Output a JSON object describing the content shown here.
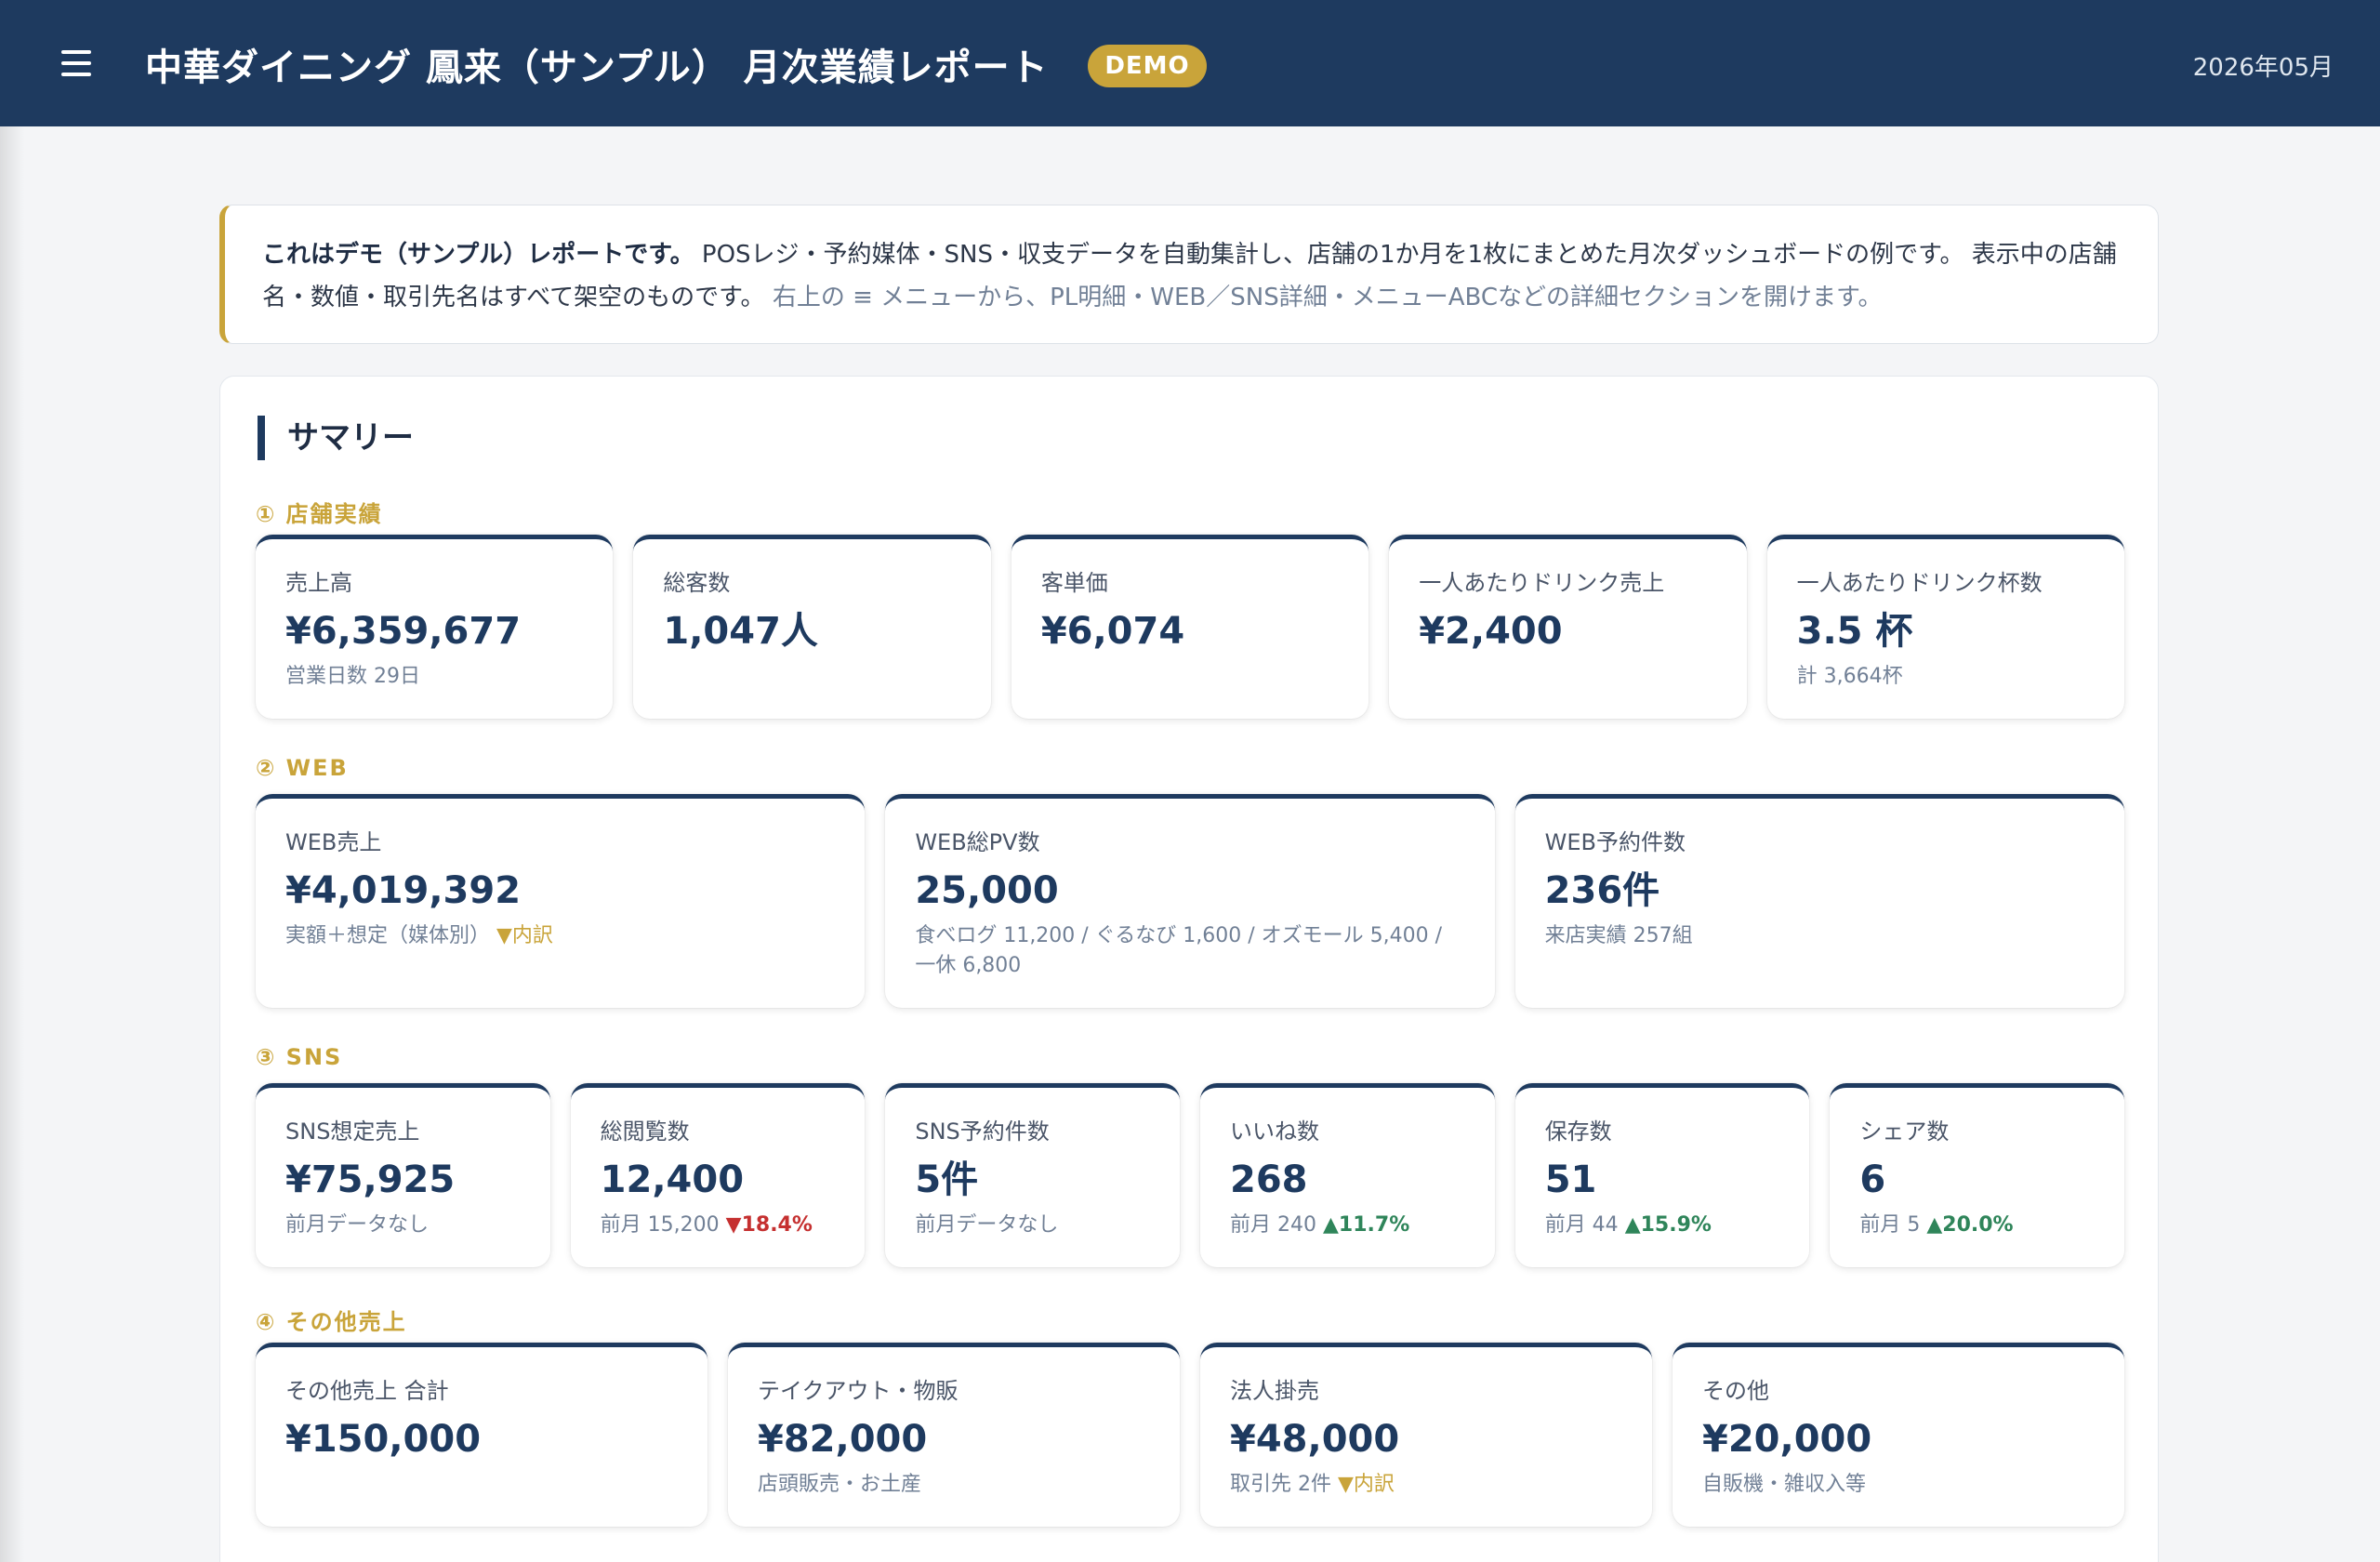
{
  "header": {
    "title": "中華ダイニング 鳳来（サンプル） 月次業績レポート",
    "badge": "DEMO",
    "date": "2026年05月"
  },
  "notice": {
    "lead": "これはデモ（サンプル）レポートです。",
    "body": "POSレジ・予約媒体・SNS・収支データを自動集計し、店舗の1か月を1枚にまとめた月次ダッシュボードの例です。 表示中の店舗名・数値・取引先名はすべて架空のものです。",
    "hint": "右上の ≡ メニューから、PL明細・WEB／SNS詳細・メニューABCなどの詳細セクションを開けます。"
  },
  "summary": {
    "title": "サマリー",
    "sections": {
      "store": {
        "label": "① 店舗実績",
        "cards": [
          {
            "label": "売上高",
            "value": "¥6,359,677",
            "sub": "営業日数 29日"
          },
          {
            "label": "総客数",
            "value": "1,047人",
            "sub": ""
          },
          {
            "label": "客単価",
            "value": "¥6,074",
            "sub": ""
          },
          {
            "label": "一人あたりドリンク売上",
            "value": "¥2,400",
            "sub": ""
          },
          {
            "label": "一人あたりドリンク杯数",
            "value": "3.5 杯",
            "sub": "計 3,664杯"
          }
        ]
      },
      "web": {
        "label": "② WEB",
        "cards": [
          {
            "label": "WEB売上",
            "value": "¥4,019,392",
            "sub": "実額＋想定（媒体別）",
            "link": "▼内訳"
          },
          {
            "label": "WEB総PV数",
            "value": "25,000",
            "sub": "食べログ 11,200 / ぐるなび 1,600 / オズモール 5,400 / 一休 6,800"
          },
          {
            "label": "WEB予約件数",
            "value": "236件",
            "sub": "来店実績 257組"
          }
        ]
      },
      "sns": {
        "label": "③ SNS",
        "cards": [
          {
            "label": "SNS想定売上",
            "value": "¥75,925",
            "sub": "前月データなし"
          },
          {
            "label": "総閲覧数",
            "value": "12,400",
            "sub": "前月 15,200",
            "change": "▼18.4%"
          },
          {
            "label": "SNS予約件数",
            "value": "5件",
            "sub": "前月データなし"
          },
          {
            "label": "いいね数",
            "value": "268",
            "sub": "前月 240",
            "change": "▲11.7%"
          },
          {
            "label": "保存数",
            "value": "51",
            "sub": "前月 44",
            "change": "▲15.9%"
          },
          {
            "label": "シェア数",
            "value": "6",
            "sub": "前月 5",
            "change": "▲20.0%"
          }
        ]
      },
      "other": {
        "label": "④ その他売上",
        "cards": [
          {
            "label": "その他売上 合計",
            "value": "¥150,000",
            "sub": ""
          },
          {
            "label": "テイクアウト・物販",
            "value": "¥82,000",
            "sub": "店頭販売・お土産"
          },
          {
            "label": "法人掛売",
            "value": "¥48,000",
            "sub": "取引先 2件",
            "link": "▼内訳"
          },
          {
            "label": "その他",
            "value": "¥20,000",
            "sub": "自販機・雑収入等"
          }
        ]
      }
    }
  },
  "colors": {
    "navy": "#1e3a5f",
    "gold": "#c9a43a",
    "down": "#c53030",
    "up": "#2f855a"
  }
}
